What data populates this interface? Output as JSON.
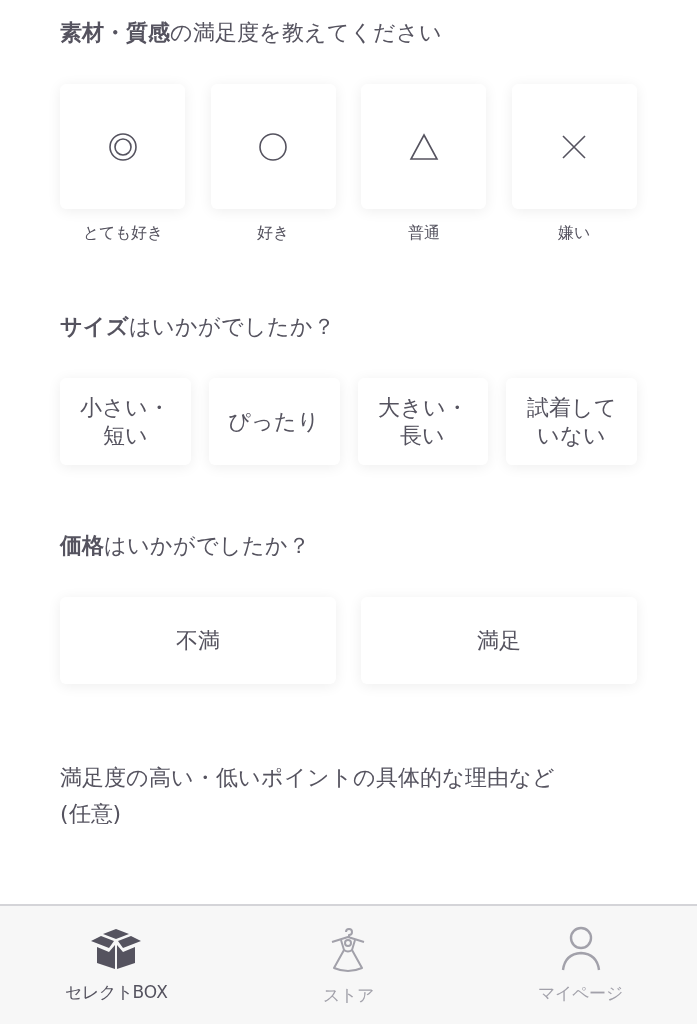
{
  "material": {
    "heading": "**素材・質感**の満足度を教えてください",
    "options": [
      {
        "kind": "double-circle",
        "label": "とても好き"
      },
      {
        "kind": "circle",
        "label": "好き"
      },
      {
        "kind": "triangle",
        "label": "普通"
      },
      {
        "kind": "cross",
        "label": "嫌い"
      }
    ]
  },
  "size": {
    "heading": "**サイズ**はいかがでしたか？",
    "options": [
      "小さい・短い",
      "ぴったり",
      "大きい・長い",
      "試着していない"
    ]
  },
  "price": {
    "heading": "**価格**はいかがでしたか？",
    "options": [
      "不満",
      "満足"
    ]
  },
  "reason": {
    "label": "満足度の高い・低いポイントの具体的な理由など(任意)"
  },
  "tab_bar": [
    {
      "kind": "box",
      "label": "セレクトBOX",
      "selected": true
    },
    {
      "kind": "dress",
      "label": "ストア",
      "selected": false
    },
    {
      "kind": "person",
      "label": "マイページ",
      "selected": false
    }
  ]
}
